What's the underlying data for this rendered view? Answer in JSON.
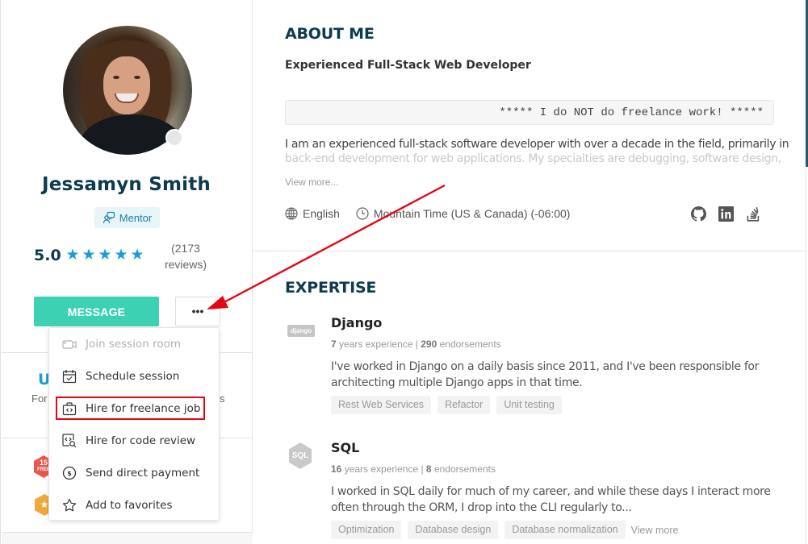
{
  "profile": {
    "name": "Jessamyn Smith",
    "role_badge": "Mentor",
    "rating": "5.0",
    "stars": 5,
    "star_glyph": "★",
    "reviews_line1": "(2173",
    "reviews_line2": "reviews)",
    "online_status": "offline",
    "message_button": "MESSAGE",
    "more_button": "•••",
    "partial_heading": "U",
    "partial_sub_left": "For",
    "partial_sub_right": "s",
    "badge_free": {
      "number": "15",
      "label": "FREE"
    },
    "badge_star": "★"
  },
  "dropdown": {
    "items": [
      {
        "label": "Join session room",
        "icon": "video-camera-icon",
        "disabled": true
      },
      {
        "label": "Schedule session",
        "icon": "calendar-check-icon",
        "disabled": false
      },
      {
        "label": "Hire for freelance job",
        "icon": "briefcase-code-icon",
        "disabled": false,
        "highlighted": true
      },
      {
        "label": "Hire for code review",
        "icon": "code-search-icon",
        "disabled": false
      },
      {
        "label": "Send direct payment",
        "icon": "dollar-circle-icon",
        "disabled": false
      },
      {
        "label": "Add to favorites",
        "icon": "star-outline-icon",
        "disabled": false
      }
    ]
  },
  "about": {
    "title": "ABOUT ME",
    "headline": "Experienced Full-Stack Web Developer",
    "code_notice": "***** I do NOT do freelance work! *****",
    "bio_line1": "I am an experienced full-stack software developer with over a decade in the field, primarily in",
    "bio_line2": "back-end development for web applications. My specialties are debugging, software design,",
    "view_more": "View more...",
    "language": "English",
    "timezone": "Mountain Time (US & Canada) (-06:00)",
    "socials": [
      "github-icon",
      "linkedin-icon",
      "stackoverflow-icon"
    ]
  },
  "expertise": {
    "title": "EXPERTISE",
    "skills": [
      {
        "name": "Django",
        "logo_text": "django",
        "years": "7",
        "years_label": "years experience",
        "separator": "|",
        "endorsements": "290",
        "endorsements_label": "endorsements",
        "description": "I've worked in Django on a daily basis since 2011, and I've been responsible for architecting multiple Django apps in that time.",
        "tags": [
          "Rest Web Services",
          "Refactor",
          "Unit testing"
        ]
      },
      {
        "name": "SQL",
        "logo_text": "SQL",
        "years": "16",
        "years_label": "years experience",
        "separator": "|",
        "endorsements": "8",
        "endorsements_label": "endorsements",
        "description": "I worked in SQL daily for much of my career, and while these days I interact more often through the ORM, I drop into the CLI regularly to...",
        "tags": [
          "Optimization",
          "Database design",
          "Database normalization"
        ],
        "view_more": "View more"
      }
    ]
  },
  "annotation": {
    "arrow_color": "#e30613",
    "highlight_color": "#e30613"
  },
  "colors": {
    "primary_dark": "#0d3b4d",
    "accent_teal": "#3dd1b4",
    "star_blue": "#1a9fd0",
    "badge_bg": "#e7f4f8"
  }
}
